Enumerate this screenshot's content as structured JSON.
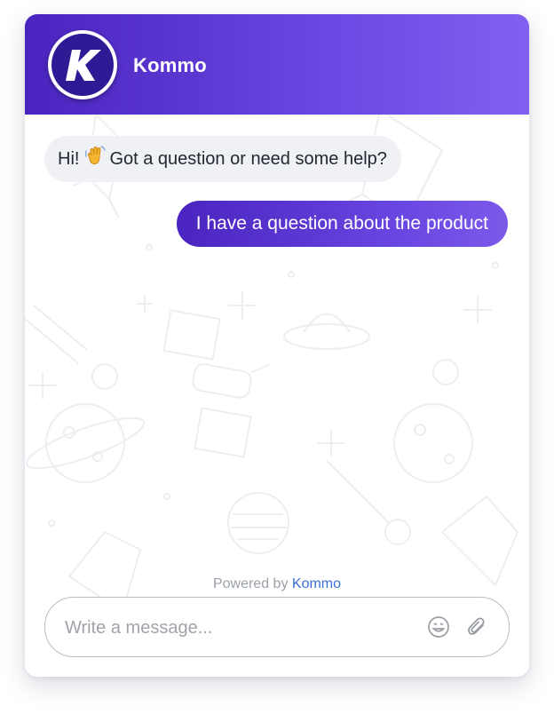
{
  "header": {
    "brand_name": "Kommo",
    "logo_letter": "K",
    "gradient_start": "#4a24bf",
    "gradient_end": "#8160f0"
  },
  "messages": [
    {
      "direction": "incoming",
      "text_before": "Hi!",
      "emoji": "waving-hand",
      "text_after": "Got a question or need some help?"
    },
    {
      "direction": "outgoing",
      "text": "I have a question about the product"
    }
  ],
  "footer": {
    "powered_prefix": "Powered by",
    "powered_brand": "Kommo",
    "link_color": "#3a6fd8"
  },
  "composer": {
    "placeholder": "Write a message...",
    "value": "",
    "icons": [
      "smiley-icon",
      "paperclip-icon"
    ]
  },
  "background_pattern": "space-doodles"
}
